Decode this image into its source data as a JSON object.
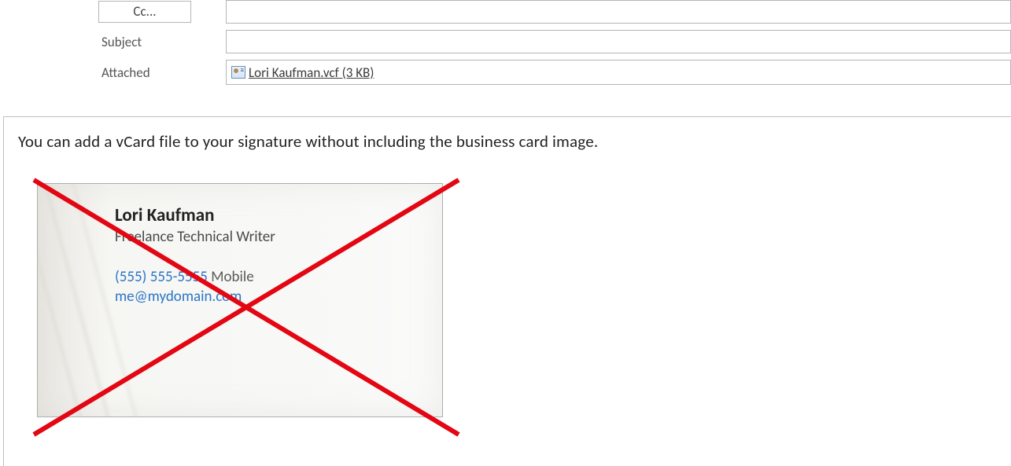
{
  "header": {
    "cc_label": "Cc...",
    "subject_label": "Subject",
    "subject_value": "",
    "attached_label": "Attached",
    "attachment": {
      "filename": "Lori Kaufman.vcf",
      "size": "3 KB",
      "display": "Lori Kaufman.vcf (3 KB)"
    }
  },
  "body": {
    "text": "You can add a vCard file to your signature without including the business card image."
  },
  "card": {
    "name": "Lori Kaufman",
    "title": "Freelance Technical Writer",
    "phone": "(555) 555-5555",
    "phone_label": "Mobile",
    "email": "me@mydomain.com"
  },
  "colors": {
    "cross": "#e30613"
  }
}
